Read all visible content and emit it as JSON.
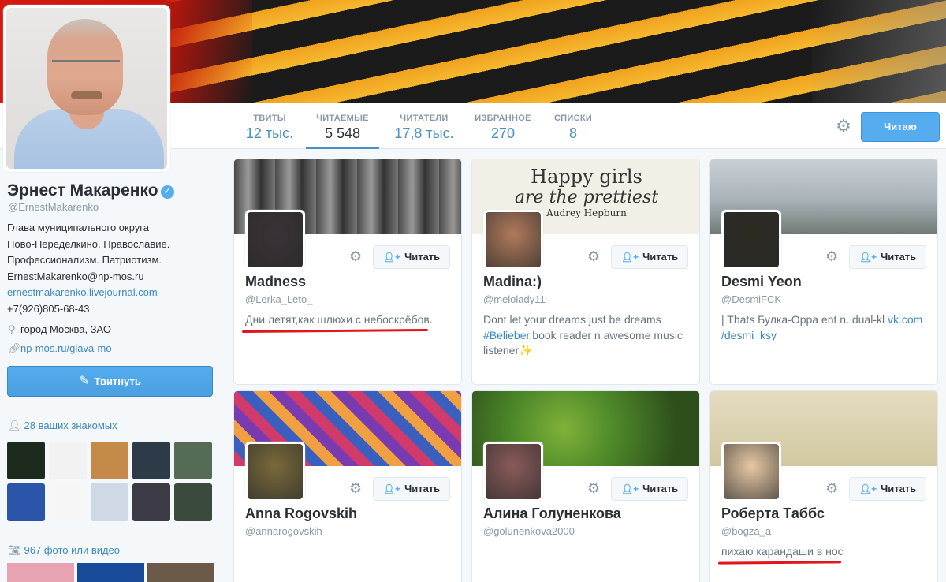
{
  "header": {
    "nav": [
      {
        "label": "ТВИТЫ",
        "value": "12 тыс.",
        "active": false
      },
      {
        "label": "ЧИТАЕМЫЕ",
        "value": "5 548",
        "active": true
      },
      {
        "label": "ЧИТАТЕЛИ",
        "value": "17,8 тыс.",
        "active": false
      },
      {
        "label": "ИЗБРАННОЕ",
        "value": "270",
        "active": false
      },
      {
        "label": "СПИСКИ",
        "value": "8",
        "active": false
      }
    ],
    "follow_label": "Читаю",
    "gear_icon": "gear-icon"
  },
  "profile": {
    "name": "Эрнест Макаренко",
    "handle": "@ErnestMakarenko",
    "bio_lines": [
      "Глава муниципального округа",
      "Ново-Переделкино. Православие.",
      "Профессионализм. Патриотизм.",
      "ErnestMakarenko@np-mos.ru"
    ],
    "bio_link": "ernestmakarenko.livejournal.com",
    "phone": "+7(926)805-68-43",
    "location": "город Москва, ЗАО",
    "url": "np-mos.ru/glava-mo",
    "tweet_button": "Твитнуть",
    "friends_label": "28 ваших знакомых",
    "photos_label": "967 фото или видео",
    "friend_colors": [
      "#1d2a1e",
      "#f2f2f2",
      "#c58a4a",
      "#2d3a48",
      "#556b55",
      "#2a55a8",
      "#f6f6f6",
      "#cfd9e6",
      "#3c3a44",
      "#3a4a3c"
    ],
    "photo_colors": [
      "#e8a3b2",
      "#1a4a9a",
      "#6b5a48"
    ]
  },
  "cards": [
    {
      "name": "Madness",
      "handle": "@Lerka_Leto_",
      "bio": "Дни летят,как шлюхи с небоскрёбов.",
      "bio_link": "",
      "follow": "Читать",
      "banner": "#6e6e6e",
      "avatar": "#3a3236",
      "underline": true
    },
    {
      "name": "Madina:)",
      "handle": "@melolady11",
      "bio": "Dont let your dreams just be dreams ",
      "bio_link": "#Belieber",
      "bio_tail": ",book reader n awesome music listener✨",
      "follow": "Читать",
      "banner": "#f2efe6",
      "banner_text_1": "Happy girls",
      "banner_text_2": "are the prettiest",
      "banner_text_3": "Audrey Hepburn",
      "avatar": "#b07a5a",
      "underline": false
    },
    {
      "name": "Desmi Yeon",
      "handle": "@DesmiFCK",
      "bio": "| Thats Булка-Oppa ent n. dual-kl ",
      "bio_link": "vk.com /desmi_ksy",
      "follow": "Читать",
      "banner": "#a9b3b8",
      "avatar": "#2b2a22",
      "underline": false
    },
    {
      "name": "Anna Rogovskih",
      "handle": "@annarogovskih",
      "bio": "",
      "bio_link": "",
      "follow": "Читать",
      "banner": "#7a3a8a",
      "avatar": "#7a6a3a",
      "underline": false
    },
    {
      "name": "Алина Голуненкова",
      "handle": "@golunenkova2000",
      "bio": "",
      "bio_link": "",
      "follow": "Читать",
      "banner": "#4f7d2c",
      "avatar": "#8a5a5a",
      "underline": false
    },
    {
      "name": "Роберта Таббс",
      "handle": "@bogza_a",
      "bio": "пихаю карандаши в нос",
      "bio_link": "",
      "follow": "Читать",
      "banner": "#d8cfa6",
      "avatar": "#e7c8a4",
      "underline": true
    }
  ]
}
